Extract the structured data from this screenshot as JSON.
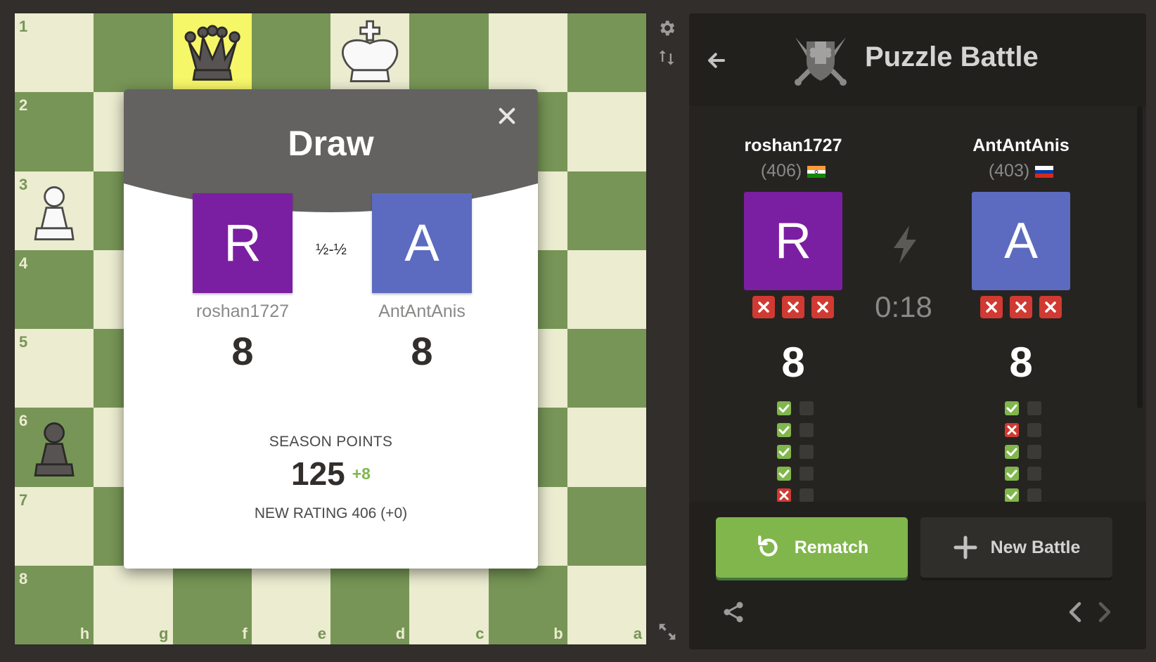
{
  "board": {
    "ranks": [
      "1",
      "2",
      "3",
      "4",
      "5",
      "6",
      "7",
      "8"
    ],
    "files": [
      "h",
      "g",
      "f",
      "e",
      "d",
      "c",
      "b",
      "a"
    ]
  },
  "modal": {
    "title": "Draw",
    "result": "½-½",
    "players": [
      {
        "initial": "R",
        "name": "roshan1727",
        "score": "8",
        "color": "#7b1fa2"
      },
      {
        "initial": "A",
        "name": "AntAntAnis",
        "score": "8",
        "color": "#5c6bc0"
      }
    ],
    "season_label": "SEASON POINTS",
    "season_points": "125",
    "season_delta": "+8",
    "new_rating": "NEW RATING 406 (+0)"
  },
  "panel": {
    "title": "Puzzle Battle",
    "timer": "0:18",
    "players": [
      {
        "name": "roshan1727",
        "rating": "(406)",
        "flag": "india-flag",
        "initial": "R",
        "score": "8",
        "color": "#7b1fa2"
      },
      {
        "name": "AntAntAnis",
        "rating": "(403)",
        "flag": "russia-flag",
        "initial": "A",
        "score": "8",
        "color": "#5c6bc0"
      }
    ],
    "results_left": [
      "ok",
      "ok",
      "ok",
      "ok",
      "bad"
    ],
    "results_right": [
      "ok",
      "bad",
      "ok",
      "ok",
      "ok"
    ],
    "rematch_label": "Rematch",
    "new_battle_label": "New Battle"
  },
  "colors": {
    "board_light": "#ebecd0",
    "board_dark": "#779556",
    "highlight": "#f6f669",
    "accent_green": "#81b64c",
    "strike_red": "#d03a32"
  }
}
